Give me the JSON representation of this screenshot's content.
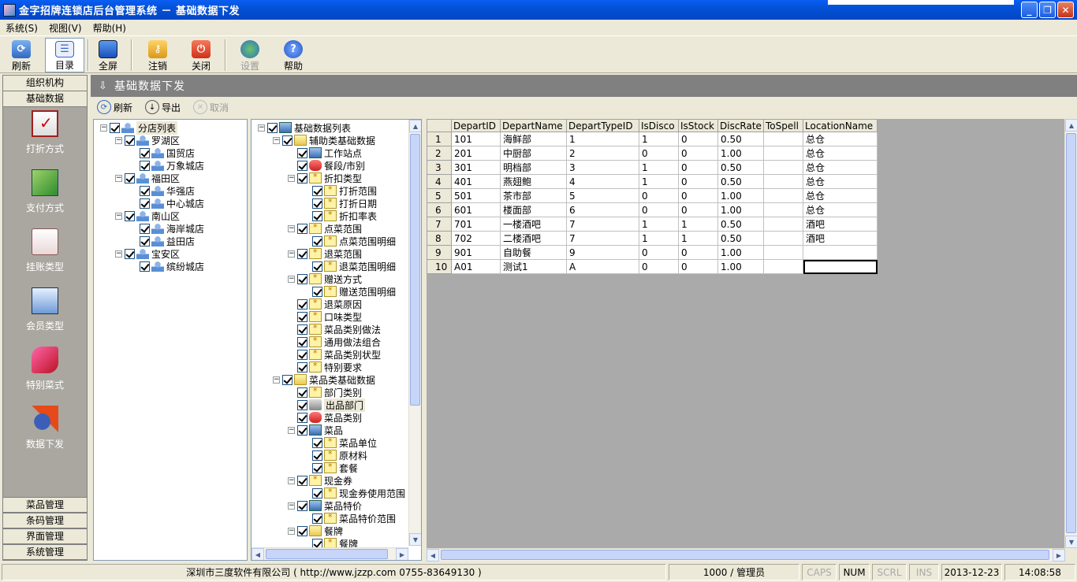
{
  "window": {
    "title": "金字招牌连锁店后台管理系统 － 基础数据下发"
  },
  "menu": [
    "系统(S)",
    "视图(V)",
    "帮助(H)"
  ],
  "toolbar": {
    "refresh": "刷新",
    "catalog": "目录",
    "fullscreen": "全屏",
    "logout": "注销",
    "close": "关闭",
    "settings": "设置",
    "help": "帮助"
  },
  "leftnav": {
    "top_sections": [
      "组织机构",
      "基础数据"
    ],
    "tiles": [
      "打折方式",
      "支付方式",
      "挂账类型",
      "会员类型",
      "特别菜式",
      "数据下发"
    ],
    "bottom_sections": [
      "菜品管理",
      "条码管理",
      "界面管理",
      "系统管理"
    ]
  },
  "main": {
    "title": "基础数据下发",
    "subtool": {
      "refresh": "刷新",
      "export": "导出",
      "cancel": "取消"
    }
  },
  "store_tree": {
    "root": "分店列表",
    "nodes": [
      {
        "label": "罗湖区",
        "level": 1,
        "expander": "−"
      },
      {
        "label": "国贸店",
        "level": 2
      },
      {
        "label": "万象城店",
        "level": 2
      },
      {
        "label": "福田区",
        "level": 1,
        "expander": "−"
      },
      {
        "label": "华强店",
        "level": 2
      },
      {
        "label": "中心城店",
        "level": 2
      },
      {
        "label": "南山区",
        "level": 1,
        "expander": "−"
      },
      {
        "label": "海岸城店",
        "level": 2
      },
      {
        "label": "益田店",
        "level": 2
      },
      {
        "label": "宝安区",
        "level": 1,
        "expander": "−"
      },
      {
        "label": "缤纷城店",
        "level": 2
      }
    ]
  },
  "data_tree": {
    "root": "基础数据列表",
    "nodes": [
      {
        "label": "辅助类基础数据",
        "level": 1,
        "expander": "−",
        "icon": "folder"
      },
      {
        "label": "工作站点",
        "level": 2,
        "icon": "pc"
      },
      {
        "label": "餐段/市别",
        "level": 2,
        "icon": "red"
      },
      {
        "label": "折扣类型",
        "level": 2,
        "expander": "−",
        "icon": "star"
      },
      {
        "label": "打折范围",
        "level": 3,
        "icon": "star"
      },
      {
        "label": "打折日期",
        "level": 3,
        "icon": "star"
      },
      {
        "label": "折扣率表",
        "level": 3,
        "icon": "star"
      },
      {
        "label": "点菜范围",
        "level": 2,
        "expander": "−",
        "icon": "star"
      },
      {
        "label": "点菜范围明细",
        "level": 3,
        "icon": "star"
      },
      {
        "label": "退菜范围",
        "level": 2,
        "expander": "−",
        "icon": "star"
      },
      {
        "label": "退菜范围明细",
        "level": 3,
        "icon": "star"
      },
      {
        "label": "赠送方式",
        "level": 2,
        "expander": "−",
        "icon": "star"
      },
      {
        "label": "赠送范围明细",
        "level": 3,
        "icon": "star"
      },
      {
        "label": "退菜原因",
        "level": 2,
        "icon": "star"
      },
      {
        "label": "口味类型",
        "level": 2,
        "icon": "star"
      },
      {
        "label": "菜品类别做法",
        "level": 2,
        "icon": "star"
      },
      {
        "label": "通用做法组合",
        "level": 2,
        "icon": "star"
      },
      {
        "label": "菜品类别状型",
        "level": 2,
        "icon": "star"
      },
      {
        "label": "特别要求",
        "level": 2,
        "icon": "star"
      },
      {
        "label": "菜品类基础数据",
        "level": 1,
        "expander": "−",
        "icon": "folder"
      },
      {
        "label": "部门类别",
        "level": 2,
        "icon": "star"
      },
      {
        "label": "出品部门",
        "level": 2,
        "icon": "grey",
        "selected": true
      },
      {
        "label": "菜品类别",
        "level": 2,
        "icon": "red"
      },
      {
        "label": "菜品",
        "level": 2,
        "expander": "−",
        "icon": "pc"
      },
      {
        "label": "菜品单位",
        "level": 3,
        "icon": "star"
      },
      {
        "label": "原材料",
        "level": 3,
        "icon": "star"
      },
      {
        "label": "套餐",
        "level": 3,
        "icon": "star"
      },
      {
        "label": "现金券",
        "level": 2,
        "expander": "−",
        "icon": "star"
      },
      {
        "label": "现金券使用范围",
        "level": 3,
        "icon": "star"
      },
      {
        "label": "菜品特价",
        "level": 2,
        "expander": "−",
        "icon": "pc"
      },
      {
        "label": "菜品特价范围",
        "level": 3,
        "icon": "star"
      },
      {
        "label": "餐牌",
        "level": 2,
        "expander": "−",
        "icon": "folder"
      },
      {
        "label": "餐牌",
        "level": 3,
        "icon": "star"
      }
    ]
  },
  "grid": {
    "columns": [
      "DepartID",
      "DepartName",
      "DepartTypeID",
      "IsDisco",
      "IsStock",
      "DiscRate",
      "ToSpell",
      "LocationName"
    ],
    "rows": [
      [
        "101",
        "海鲜部",
        "1",
        "1",
        "0",
        "0.50",
        "",
        "总仓"
      ],
      [
        "201",
        "中厨部",
        "2",
        "0",
        "0",
        "1.00",
        "",
        "总仓"
      ],
      [
        "301",
        "明档部",
        "3",
        "1",
        "0",
        "0.50",
        "",
        "总仓"
      ],
      [
        "401",
        "燕翅鲍",
        "4",
        "1",
        "0",
        "0.50",
        "",
        "总仓"
      ],
      [
        "501",
        "茶市部",
        "5",
        "0",
        "0",
        "1.00",
        "",
        "总仓"
      ],
      [
        "601",
        "楼面部",
        "6",
        "0",
        "0",
        "1.00",
        "",
        "总仓"
      ],
      [
        "701",
        "一楼酒吧",
        "7",
        "1",
        "1",
        "0.50",
        "",
        "酒吧"
      ],
      [
        "702",
        "二楼酒吧",
        "7",
        "1",
        "1",
        "0.50",
        "",
        "酒吧"
      ],
      [
        "901",
        "自助餐",
        "9",
        "0",
        "0",
        "1.00",
        "",
        ""
      ],
      [
        "A01",
        "测试1",
        "A",
        "0",
        "0",
        "1.00",
        "",
        ""
      ]
    ]
  },
  "statusbar": {
    "company": "深圳市三度软件有限公司 ( http://www.jzzp.com  0755-83649130 )",
    "user": "1000 / 管理员",
    "caps": "CAPS",
    "num": "NUM",
    "scrl": "SCRL",
    "ins": "INS",
    "date": "2013-12-23",
    "time": "14:08:58"
  }
}
